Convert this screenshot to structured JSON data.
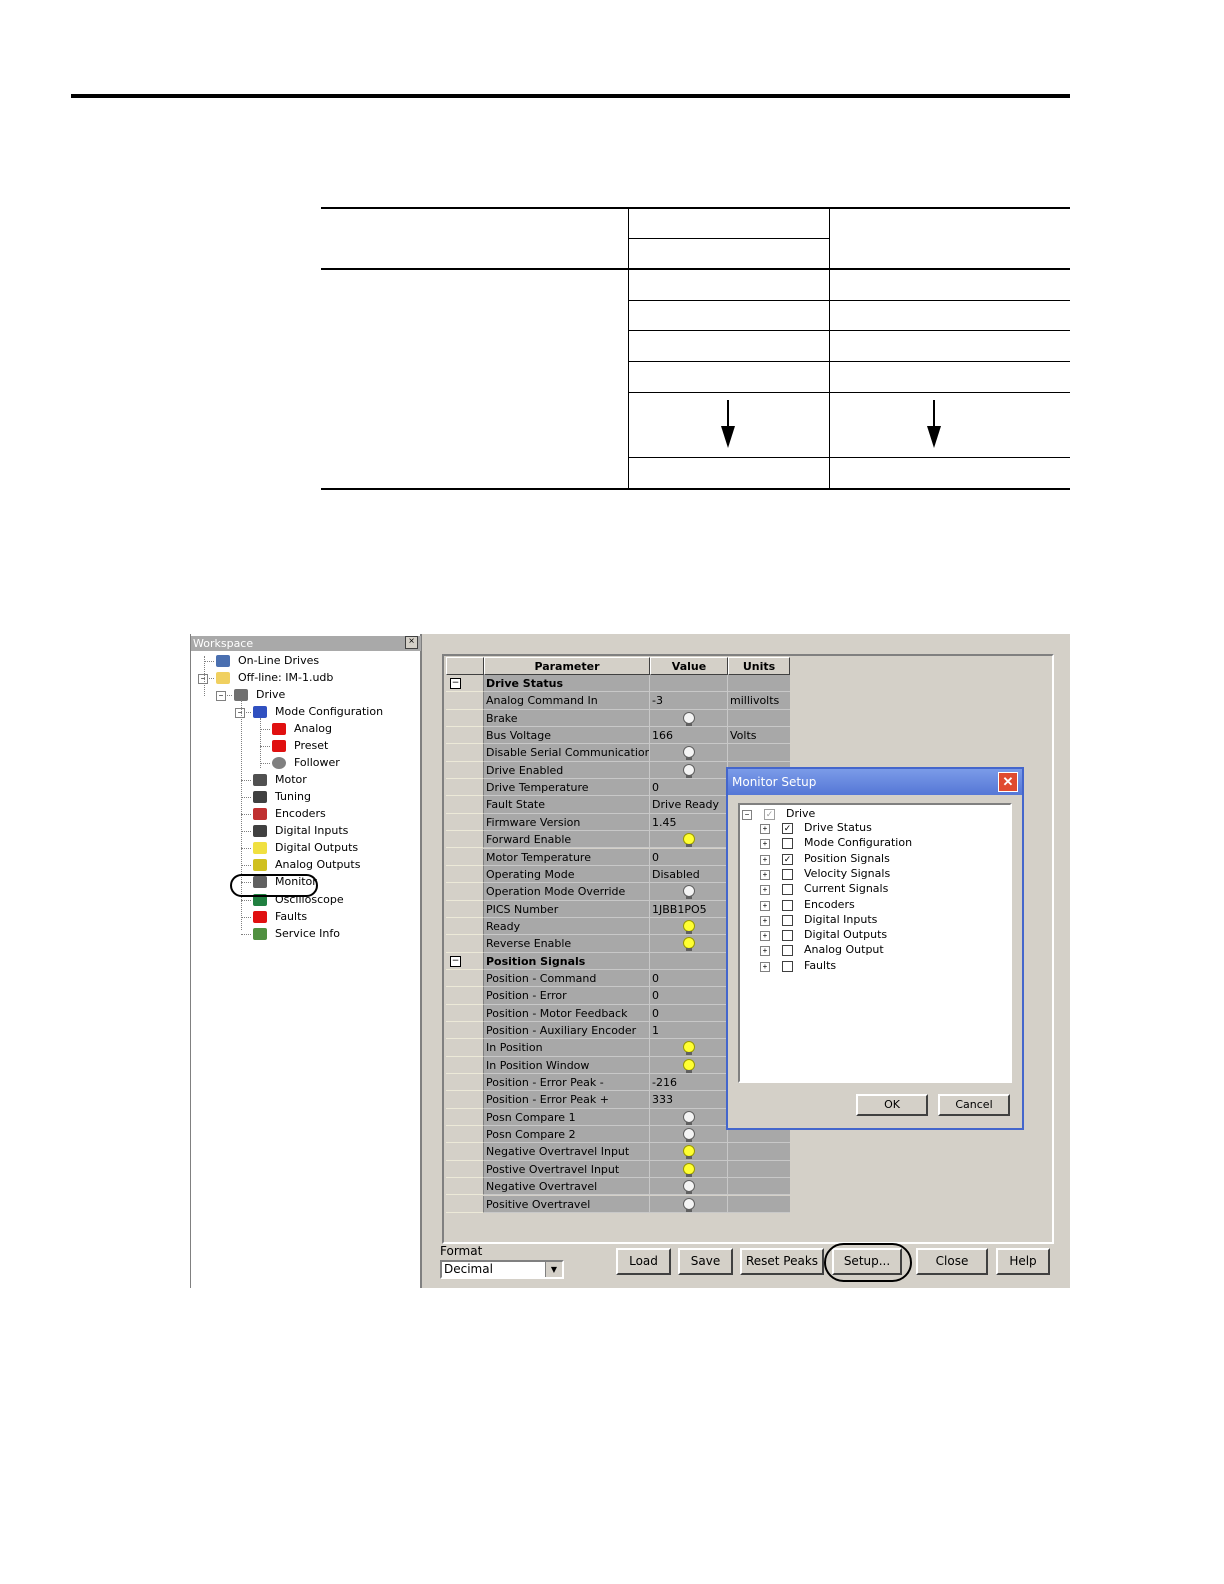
{
  "workspace": {
    "title": "Workspace",
    "close_glyph": "×",
    "tree": [
      {
        "label": "On-Line Drives",
        "icon": "online-drives-icon"
      },
      {
        "label": "Off-line: IM-1.udb",
        "icon": "folder-icon"
      },
      {
        "label": "Drive",
        "icon": "drive-icon"
      },
      {
        "label": "Mode Configuration",
        "icon": "mode-config-icon"
      },
      {
        "label": "Analog",
        "icon": "analog-icon"
      },
      {
        "label": "Preset",
        "icon": "preset-icon"
      },
      {
        "label": "Follower",
        "icon": "follower-icon"
      },
      {
        "label": "Motor",
        "icon": "motor-icon"
      },
      {
        "label": "Tuning",
        "icon": "tuning-icon"
      },
      {
        "label": "Encoders",
        "icon": "encoder-icon"
      },
      {
        "label": "Digital Inputs",
        "icon": "digital-inputs-icon"
      },
      {
        "label": "Digital Outputs",
        "icon": "bulb-icon"
      },
      {
        "label": "Analog Outputs",
        "icon": "analog-outputs-icon"
      },
      {
        "label": "Monitor",
        "icon": "monitor-icon"
      },
      {
        "label": "Oscilloscope",
        "icon": "oscilloscope-icon"
      },
      {
        "label": "Faults",
        "icon": "warning-icon"
      },
      {
        "label": "Service Info",
        "icon": "service-info-icon"
      }
    ]
  },
  "grid": {
    "headers": [
      "Parameter",
      "Value",
      "Units"
    ],
    "rows": [
      {
        "type": "section",
        "parameter": "Drive Status"
      },
      {
        "parameter": "Analog Command In",
        "value": "-3",
        "units": "millivolts"
      },
      {
        "parameter": "Brake",
        "bulb": "off"
      },
      {
        "parameter": "Bus Voltage",
        "value": "166",
        "units": "Volts"
      },
      {
        "parameter": "Disable Serial Communications",
        "bulb": "off"
      },
      {
        "parameter": "Drive Enabled",
        "bulb": "off"
      },
      {
        "parameter": "Drive Temperature",
        "value": "0"
      },
      {
        "parameter": "Fault State",
        "value": "Drive Ready"
      },
      {
        "parameter": "Firmware Version",
        "value": "1.45"
      },
      {
        "parameter": "Forward Enable",
        "bulb": "on"
      },
      {
        "parameter": "Motor Temperature",
        "value": "0"
      },
      {
        "parameter": "Operating Mode",
        "value": "Disabled"
      },
      {
        "parameter": "Operation Mode Override",
        "bulb": "off"
      },
      {
        "parameter": "PICS Number",
        "value": "1JBB1PO5"
      },
      {
        "parameter": "Ready",
        "bulb": "on"
      },
      {
        "parameter": "Reverse Enable",
        "bulb": "on"
      },
      {
        "type": "section",
        "parameter": "Position Signals"
      },
      {
        "parameter": "Position - Command",
        "value": "0"
      },
      {
        "parameter": "Position - Error",
        "value": "0"
      },
      {
        "parameter": "Position - Motor Feedback",
        "value": "0"
      },
      {
        "parameter": "Position - Auxiliary Encoder",
        "value": "1"
      },
      {
        "parameter": "In Position",
        "bulb": "on"
      },
      {
        "parameter": "In Position Window",
        "bulb": "on"
      },
      {
        "parameter": "Position - Error Peak -",
        "value": "-216"
      },
      {
        "parameter": "Position - Error Peak +",
        "value": "333"
      },
      {
        "parameter": "Posn Compare 1",
        "bulb": "off"
      },
      {
        "parameter": "Posn Compare 2",
        "bulb": "off"
      },
      {
        "parameter": "Negative Overtravel Input",
        "bulb": "on"
      },
      {
        "parameter": "Postive Overtravel Input",
        "bulb": "on"
      },
      {
        "parameter": "Negative Overtravel",
        "bulb": "off"
      },
      {
        "parameter": "Positive Overtravel",
        "bulb": "off"
      }
    ]
  },
  "footer": {
    "format_label": "Format",
    "format_value": "Decimal",
    "dropdown_glyph": "▼",
    "buttons": [
      "Load",
      "Save",
      "Reset Peaks",
      "Setup...",
      "Close",
      "Help"
    ]
  },
  "dialog": {
    "title": "Monitor Setup",
    "close_glyph": "✕",
    "root": {
      "label": "Drive",
      "checked": true
    },
    "items": [
      {
        "label": "Drive Status",
        "checked": true
      },
      {
        "label": "Mode Configuration",
        "checked": false
      },
      {
        "label": "Position Signals",
        "checked": true
      },
      {
        "label": "Velocity Signals",
        "checked": false
      },
      {
        "label": "Current Signals",
        "checked": false
      },
      {
        "label": "Encoders",
        "checked": false
      },
      {
        "label": "Digital Inputs",
        "checked": false
      },
      {
        "label": "Digital Outputs",
        "checked": false
      },
      {
        "label": "Analog Output",
        "checked": false
      },
      {
        "label": "Faults",
        "checked": false
      }
    ],
    "ok_label": "OK",
    "cancel_label": "Cancel"
  },
  "colors": {
    "bulb_on": "#ffff33",
    "bulb_off": "#f4f4f4",
    "dialog_title": "#5577d6",
    "grid_cell": "#a8a8a8"
  }
}
